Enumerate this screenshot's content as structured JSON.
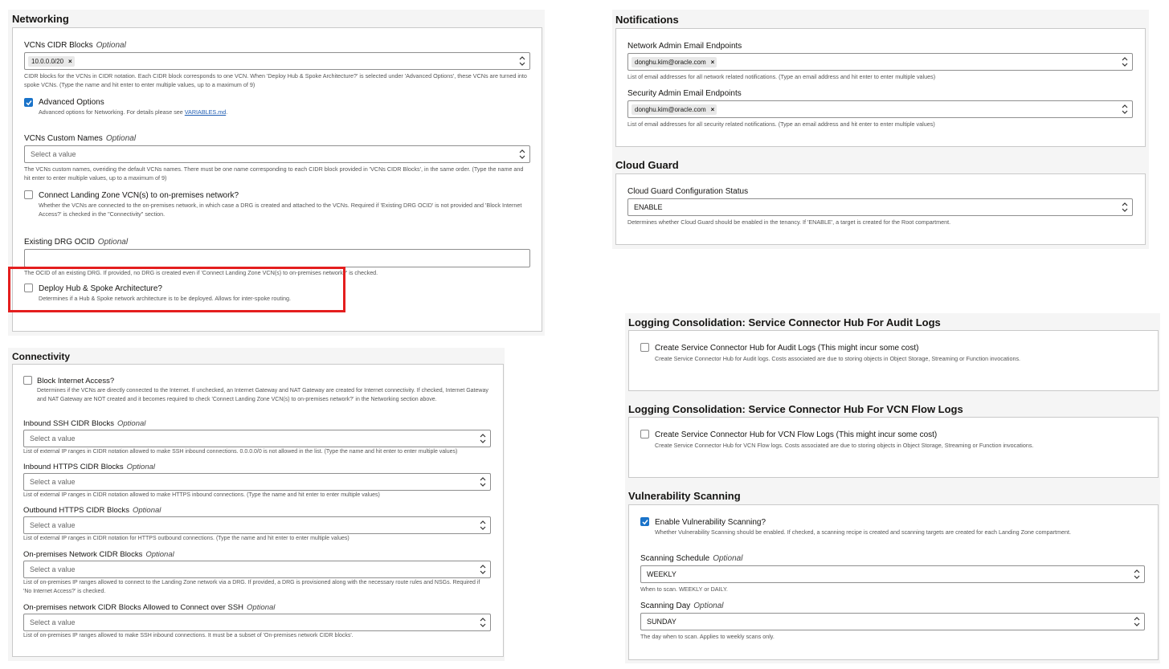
{
  "networking": {
    "title": "Networking",
    "vcns_cidr": {
      "label": "VCNs CIDR Blocks",
      "optional": "Optional",
      "chip": "10.0.0.0/20",
      "chip_remove": "×",
      "help": "CIDR blocks for the VCNs in CIDR notation. Each CIDR block corresponds to one VCN. When 'Deploy Hub & Spoke Architecture?' is selected under 'Advanced Options', these VCNs are turned into spoke VCNs. (Type the name and hit enter to enter multiple values, up to a maximum of 9)"
    },
    "advanced": {
      "label": "Advanced Options",
      "checked": true,
      "help_prefix": "Advanced options for Networking. For details please see ",
      "help_link": "VARIABLES.md",
      "help_suffix": "."
    },
    "custom_names": {
      "label": "VCNs Custom Names",
      "optional": "Optional",
      "placeholder": "Select a value",
      "help": "The VCNs custom names, overiding the default VCNs names. There must be one name corresponding to each CIDR block provided in 'VCNs CIDR Blocks', in the same order. (Type the name and hit enter to enter multiple values, up to a maximum of 9)"
    },
    "connect_onprem": {
      "label": "Connect Landing Zone VCN(s) to on-premises network?",
      "checked": false,
      "help": "Whether the VCNs are connected to the on-premises network, in which case a DRG is created and attached to the VCNs. Required if 'Existing DRG OCID' is not provided and 'Block Internet Access?' is checked in the \"Connectivity\" section."
    },
    "drg_ocid": {
      "label": "Existing DRG OCID",
      "optional": "Optional",
      "help": "The OCID of an existing DRG. If provided, no DRG is created even if 'Connect Landing Zone VCN(s) to on-premises network?' is checked."
    },
    "hub_spoke": {
      "label": "Deploy Hub & Spoke Architecture?",
      "checked": false,
      "help": "Determines if a Hub & Spoke network architecture is to be deployed. Allows for inter-spoke routing."
    }
  },
  "connectivity": {
    "title": "Connectivity",
    "block_internet": {
      "label": "Block Internet Access?",
      "checked": false,
      "help": "Determines if the VCNs are directly connected to the Internet. If unchecked, an Internet Gateway and NAT Gateway are created for Internet connectivity. If checked, Internet Gateway and NAT Gateway are NOT created and it becomes required to check 'Connect Landing Zone VCN(s) to on-premises network?' in the Networking section above."
    },
    "ssh_cidr": {
      "label": "Inbound SSH CIDR Blocks",
      "optional": "Optional",
      "placeholder": "Select a value",
      "help": "List of external IP ranges in CIDR notation allowed to make SSH inbound connections. 0.0.0.0/0 is not allowed in the list. (Type the name and hit enter to enter multiple values)"
    },
    "https_in": {
      "label": "Inbound HTTPS CIDR Blocks",
      "optional": "Optional",
      "placeholder": "Select a value",
      "help": "List of external IP ranges in CIDR notation allowed to make HTTPS inbound connections. (Type the name and hit enter to enter multiple values)"
    },
    "https_out": {
      "label": "Outbound HTTPS CIDR Blocks",
      "optional": "Optional",
      "placeholder": "Select a value",
      "help": "List of external IP ranges in CIDR notation for HTTPS outbound connections. (Type the name and hit enter to enter multiple values)"
    },
    "onprem_cidr": {
      "label": "On-premises Network CIDR Blocks",
      "optional": "Optional",
      "placeholder": "Select a value",
      "help": "List of on-premises IP ranges allowed to connect to the Landing Zone network via a DRG. If provided, a DRG is provisioned along with the necessary route rules and NSGs. Required if 'No Internet Access?' is checked."
    },
    "onprem_ssh": {
      "label": "On-premises network CIDR Blocks Allowed to Connect over SSH",
      "optional": "Optional",
      "placeholder": "Select a value",
      "help": "List of on-premises IP ranges allowed to make SSH inbound connections. It must be a subset of 'On-premises network CIDR blocks'."
    }
  },
  "notifications": {
    "title": "Notifications",
    "network_admin": {
      "label": "Network Admin Email Endpoints",
      "chip": "donghu.kim@oracle.com",
      "chip_remove": "×",
      "help": "List of email addresses for all network related notifications. (Type an email address and hit enter to enter multiple values)"
    },
    "security_admin": {
      "label": "Security Admin Email Endpoints",
      "chip": "donghu.kim@oracle.com",
      "chip_remove": "×",
      "help": "List of email addresses for all security related notifications. (Type an email address and hit enter to enter multiple values)"
    }
  },
  "cloud_guard": {
    "title": "Cloud Guard",
    "label": "Cloud Guard Configuration Status",
    "value": "ENABLE",
    "help": "Determines whether Cloud Guard should be enabled in the tenancy. If 'ENABLE', a target is created for the Root compartment."
  },
  "audit_logs": {
    "title": "Logging Consolidation: Service Connector Hub For Audit Logs",
    "label": "Create Service Connector Hub for Audit Logs (This might incur some cost)",
    "checked": false,
    "help": "Create Service Connector Hub for Audit logs. Costs associated are due to storing objects in Object Storage, Streaming or Function invocations."
  },
  "flow_logs": {
    "title": "Logging Consolidation: Service Connector Hub For VCN Flow Logs",
    "label": "Create Service Connector Hub for VCN Flow Logs (This might incur some cost)",
    "checked": false,
    "help": "Create Service Connector Hub for VCN Flow logs. Costs associated are due to storing objects in Object Storage, Streaming or Function invocations."
  },
  "vuln": {
    "title": "Vulnerability Scanning",
    "enable": {
      "label": "Enable Vulnerability Scanning?",
      "checked": true,
      "help": "Whether Vulnerability Scanning should be enabled. If checked, a scanning recipe is created and scanning targets are created for each Landing Zone compartment."
    },
    "schedule": {
      "label": "Scanning Schedule",
      "optional": "Optional",
      "value": "WEEKLY",
      "help": "When to scan. WEEKLY or DAILY."
    },
    "day": {
      "label": "Scanning Day",
      "optional": "Optional",
      "value": "SUNDAY",
      "help": "The day when to scan. Applies to weekly scans only."
    }
  },
  "colors": {
    "checkbox_checked": "#1a73c9",
    "highlight": "#e41e1e",
    "link": "#1f5db3"
  }
}
